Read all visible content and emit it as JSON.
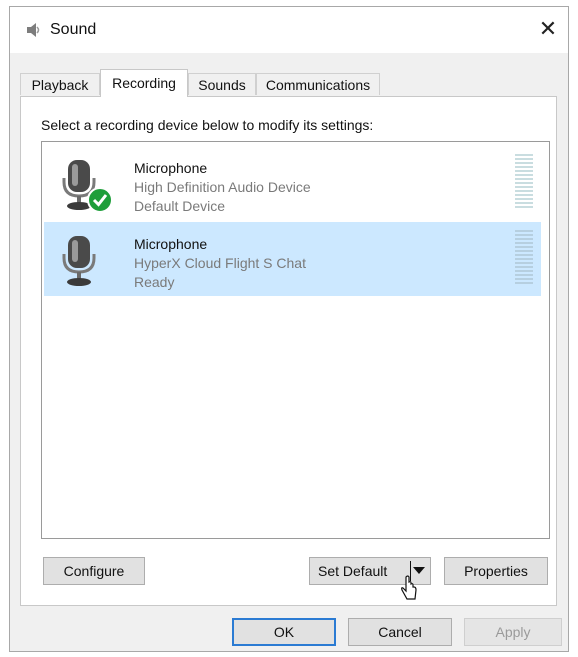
{
  "window": {
    "title": "Sound",
    "close_glyph": "✕"
  },
  "tabs": [
    {
      "label": "Playback",
      "active": false
    },
    {
      "label": "Recording",
      "active": true
    },
    {
      "label": "Sounds",
      "active": false
    },
    {
      "label": "Communications",
      "active": false
    }
  ],
  "panel": {
    "instruction": "Select a recording device below to modify its settings:"
  },
  "devices": [
    {
      "name": "Microphone",
      "description": "High Definition Audio Device",
      "status": "Default Device",
      "selected": false,
      "default_badge": "check-icon"
    },
    {
      "name": "Microphone",
      "description": "HyperX Cloud Flight S Chat",
      "status": "Ready",
      "selected": true
    }
  ],
  "buttons": {
    "configure": "Configure",
    "set_default": "Set Default",
    "properties": "Properties",
    "ok": "OK",
    "cancel": "Cancel",
    "apply": "Apply"
  },
  "colors": {
    "selection": "#cce8ff",
    "focus_border": "#2b7bd3",
    "default_badge": "#1e9e3a",
    "meter": "#c9dde0"
  }
}
